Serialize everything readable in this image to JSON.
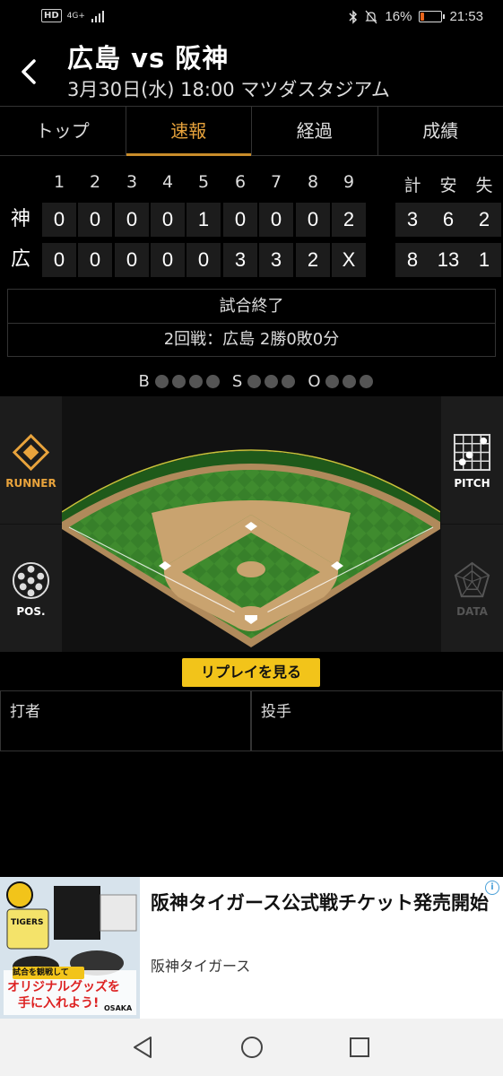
{
  "status_bar": {
    "hd": "HD",
    "network": "4G+",
    "battery": "16%",
    "battery_level": 0.16,
    "time": "21:53"
  },
  "header": {
    "title": "広島 vs 阪神",
    "subtitle": "3月30日(水) 18:00 マツダスタジアム"
  },
  "tabs": [
    {
      "label": "トップ",
      "active": false
    },
    {
      "label": "速報",
      "active": true
    },
    {
      "label": "経過",
      "active": false
    },
    {
      "label": "成績",
      "active": false
    }
  ],
  "scoreboard": {
    "innings": [
      "1",
      "2",
      "3",
      "4",
      "5",
      "6",
      "7",
      "8",
      "9"
    ],
    "total_headers": [
      "計",
      "安",
      "失"
    ],
    "teams": [
      {
        "name": "神",
        "scores": [
          "0",
          "0",
          "0",
          "0",
          "1",
          "0",
          "0",
          "0",
          "2"
        ],
        "totals": [
          "3",
          "6",
          "2"
        ]
      },
      {
        "name": "広",
        "scores": [
          "0",
          "0",
          "0",
          "0",
          "0",
          "3",
          "3",
          "2",
          "X"
        ],
        "totals": [
          "8",
          "13",
          "1"
        ]
      }
    ]
  },
  "game_status": {
    "state": "試合終了",
    "series": "2回戦：広島 2勝0敗0分"
  },
  "bso": {
    "b": "B",
    "s": "S",
    "o": "O",
    "balls": 0,
    "strikes": 0,
    "outs": 0
  },
  "side_buttons": {
    "runner": "RUNNER",
    "pitch": "PITCH",
    "pos": "POS.",
    "data": "DATA"
  },
  "replay": {
    "label": "リプレイを見る"
  },
  "players": {
    "batter": "打者",
    "pitcher": "投手"
  },
  "ad": {
    "title": "阪神タイガース公式戦チケット発売開始",
    "advertiser": "阪神タイガース",
    "image_text_1": "試合を観戦して",
    "image_text_2": "オリジナルグッズを",
    "image_text_3": "手に入れよう!",
    "image_brand": "TIGERS",
    "image_city": "OSAKA"
  },
  "colors": {
    "accent": "#e8a33c",
    "replay": "#f2c41a",
    "grass": "#3d8a2c",
    "dirt": "#c9a36f"
  }
}
